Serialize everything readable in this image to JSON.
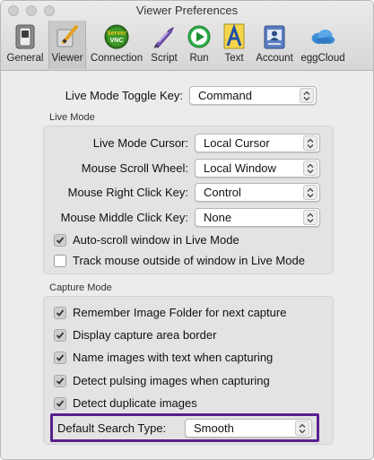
{
  "window": {
    "title": "Viewer Preferences"
  },
  "toolbar": {
    "items": [
      {
        "label": "General",
        "icon": "general-switch-icon"
      },
      {
        "label": "Viewer",
        "icon": "viewer-pencil-icon",
        "selected": true
      },
      {
        "label": "Connection",
        "icon": "connection-badge-icon",
        "badge_top": "Server",
        "badge_bottom": "VNC"
      },
      {
        "label": "Script",
        "icon": "script-quill-icon"
      },
      {
        "label": "Run",
        "icon": "run-play-icon"
      },
      {
        "label": "Text",
        "icon": "text-a-icon"
      },
      {
        "label": "Account",
        "icon": "account-id-icon"
      },
      {
        "label": "eggCloud",
        "icon": "eggcloud-icon"
      }
    ]
  },
  "live_mode_toggle": {
    "label": "Live Mode Toggle Key:",
    "value": "Command"
  },
  "live_mode": {
    "title": "Live Mode",
    "cursor": {
      "label": "Live Mode Cursor:",
      "value": "Local Cursor"
    },
    "scroll_wheel": {
      "label": "Mouse Scroll Wheel:",
      "value": "Local Window"
    },
    "right_click": {
      "label": "Mouse Right Click Key:",
      "value": "Control"
    },
    "middle_click": {
      "label": "Mouse Middle Click Key:",
      "value": "None"
    },
    "auto_scroll": {
      "label": "Auto-scroll window in Live Mode",
      "checked": true
    },
    "track_mouse": {
      "label": "Track mouse outside of window in Live Mode",
      "checked": false
    }
  },
  "capture_mode": {
    "title": "Capture Mode",
    "remember_folder": {
      "label": "Remember Image Folder for next capture",
      "checked": true
    },
    "display_border": {
      "label": "Display capture area border",
      "checked": true
    },
    "name_images": {
      "label": "Name images with text when capturing",
      "checked": true
    },
    "detect_pulsing": {
      "label": "Detect pulsing images when capturing",
      "checked": true
    },
    "detect_duplicates": {
      "label": "Detect duplicate images",
      "checked": true
    },
    "search_type": {
      "label": "Default Search Type:",
      "value": "Smooth"
    }
  },
  "colors": {
    "highlight": "#5a1f8c",
    "window_bg": "#ececec"
  }
}
